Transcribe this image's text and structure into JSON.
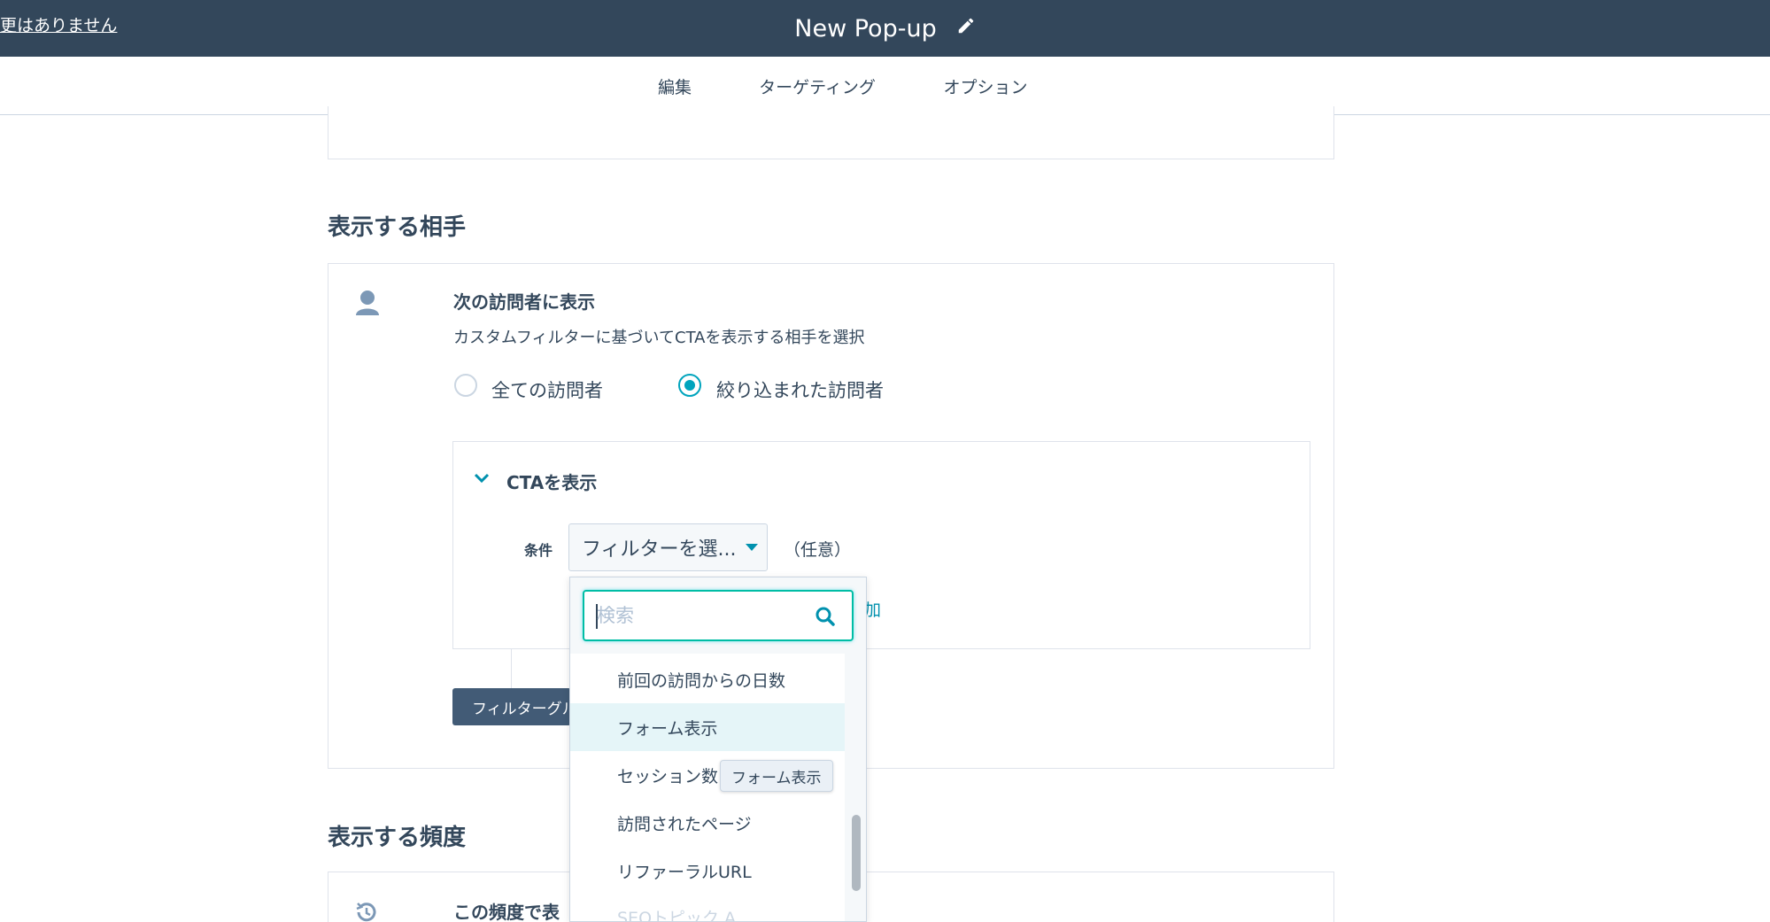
{
  "header": {
    "left_link": "更はありません",
    "title": "New Pop-up"
  },
  "tabs": [
    {
      "label": "編集"
    },
    {
      "label": "ターゲティング"
    },
    {
      "label": "オプション"
    }
  ],
  "audience": {
    "section_title": "表示する相手",
    "heading": "次の訪問者に表示",
    "description": "カスタムフィルターに基づいてCTAを表示する相手を選択",
    "radio_all": "全ての訪問者",
    "radio_filtered": "絞り込まれた訪問者",
    "panel_title": "CTAを表示",
    "condition_label": "条件",
    "filter_select": "フィルターを選...",
    "optional": "（任意）",
    "add_link_fragment": "加",
    "filter_group_button": "フィルターグル"
  },
  "frequency": {
    "section_title": "表示する頻度",
    "heading": "この頻度で表"
  },
  "dropdown": {
    "search_placeholder": "検索",
    "options": [
      {
        "label": "前回の訪問からの日数"
      },
      {
        "label": "フォーム表示"
      },
      {
        "label": "セッション数"
      },
      {
        "label": "訪問されたページ"
      },
      {
        "label": "リファーラルURL"
      },
      {
        "label": "SEOトピック A"
      }
    ],
    "tooltip": "フォーム表示"
  },
  "colors": {
    "header_bg": "#33475b",
    "accent_teal": "#00a4bd",
    "hover_bg": "#e5f5f8"
  }
}
